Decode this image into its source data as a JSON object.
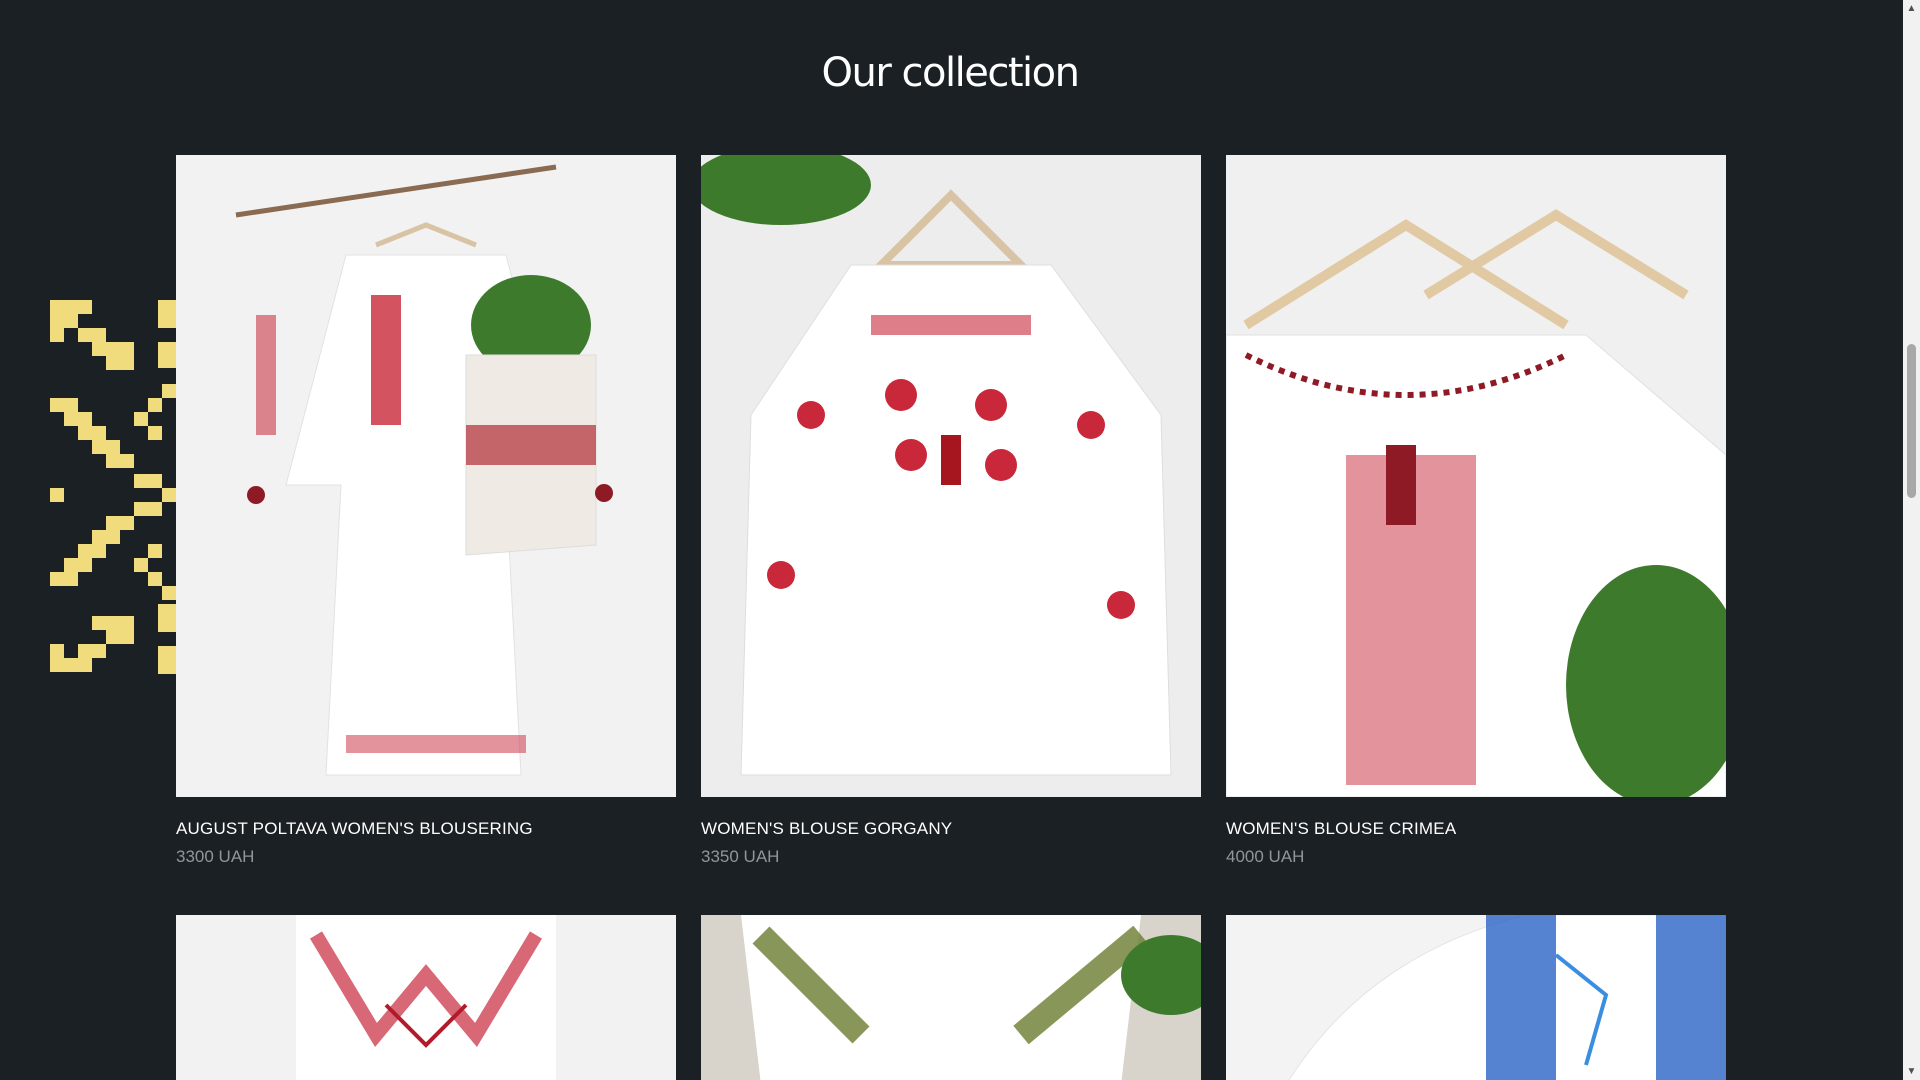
{
  "section": {
    "title": "Our collection"
  },
  "colors": {
    "background": "#1b2024",
    "ornament": "#f1dc7d",
    "price": "#8f969b"
  },
  "products": [
    {
      "name": "AUGUST POLTAVA WOMEN'S BLOUSERING",
      "price": "3300 UAH",
      "image": "white embroidered dress on hanger"
    },
    {
      "name": "WOMEN'S BLOUSE GORGANY",
      "price": "3350 UAH",
      "image": "white blouse with red roses"
    },
    {
      "name": "WOMEN'S BLOUSE CRIMEA",
      "price": "4000 UAH",
      "image": "white blouses on hangers"
    },
    {
      "image": "white shirt with red embroidery"
    },
    {
      "image": "white shirt with green embroidery"
    },
    {
      "image": "white shirt with blue embroidery"
    }
  ],
  "scrollbar": {
    "up_icon": "triangle-up",
    "down_icon": "triangle-down"
  }
}
